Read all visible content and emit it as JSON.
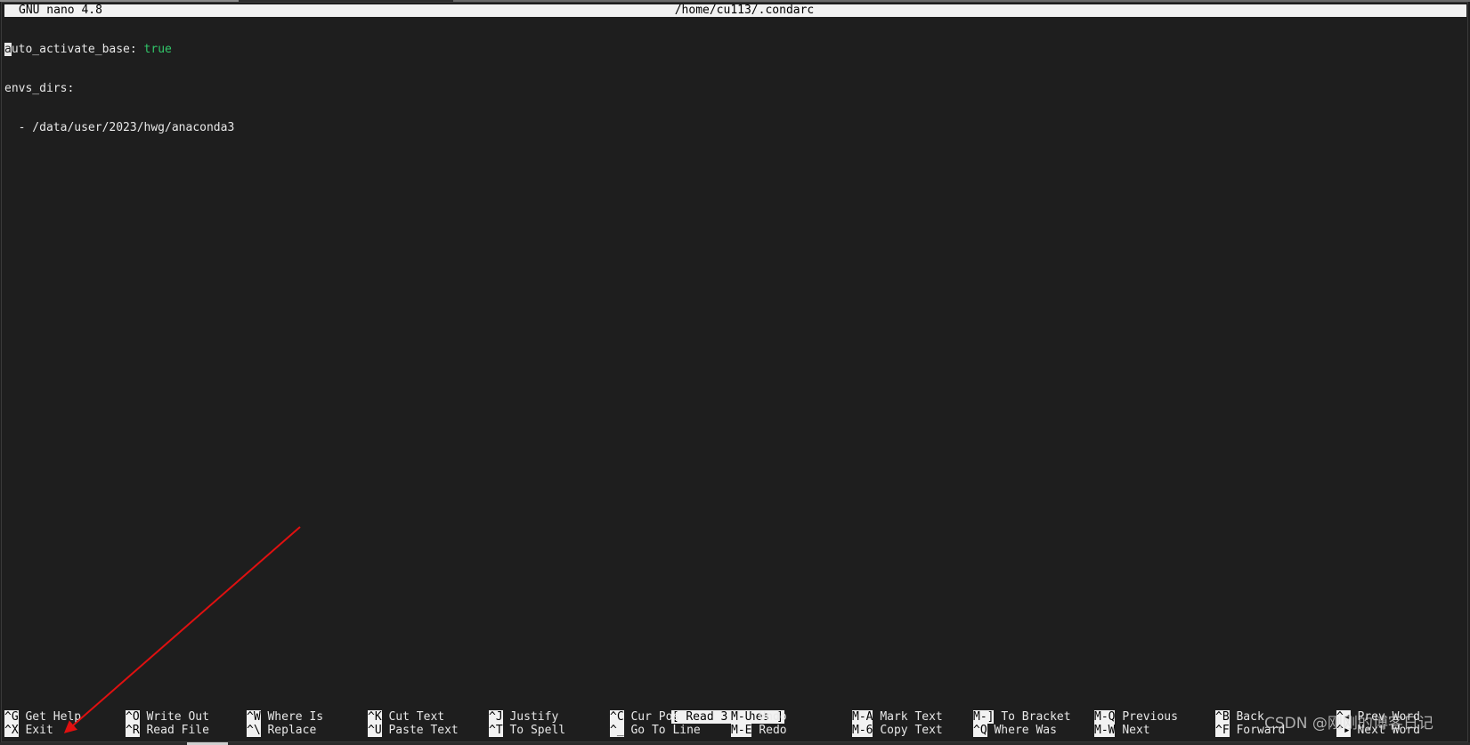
{
  "titlebar": {
    "app": "GNU nano 4.8",
    "file_path": "/home/cu113/.condarc"
  },
  "editor": {
    "cursor_char": "a",
    "line1_key_rest": "uto_activate_base:",
    "line1_value": "true",
    "line2": "envs_dirs:",
    "line3": "  - /data/user/2023/hwg/anaconda3"
  },
  "status_message": "[ Read 3 lines ]",
  "shortcuts": {
    "row1": [
      {
        "key": "^G",
        "label": "Get Help"
      },
      {
        "key": "^O",
        "label": "Write Out"
      },
      {
        "key": "^W",
        "label": "Where Is"
      },
      {
        "key": "^K",
        "label": "Cut Text"
      },
      {
        "key": "^J",
        "label": "Justify"
      },
      {
        "key": "^C",
        "label": "Cur Pos"
      },
      {
        "key": "M-U",
        "label": "Undo"
      },
      {
        "key": "M-A",
        "label": "Mark Text"
      },
      {
        "key": "M-]",
        "label": "To Bracket"
      },
      {
        "key": "M-Q",
        "label": "Previous"
      },
      {
        "key": "^B",
        "label": "Back"
      },
      {
        "key": "^◂",
        "label": "Prev Word"
      }
    ],
    "row2": [
      {
        "key": "^X",
        "label": "Exit"
      },
      {
        "key": "^R",
        "label": "Read File"
      },
      {
        "key": "^\\",
        "label": "Replace"
      },
      {
        "key": "^U",
        "label": "Paste Text"
      },
      {
        "key": "^T",
        "label": "To Spell"
      },
      {
        "key": "^_",
        "label": "Go To Line"
      },
      {
        "key": "M-E",
        "label": "Redo"
      },
      {
        "key": "M-6",
        "label": "Copy Text"
      },
      {
        "key": "^Q",
        "label": "Where Was"
      },
      {
        "key": "M-W",
        "label": "Next"
      },
      {
        "key": "^F",
        "label": "Forward"
      },
      {
        "key": "^▸",
        "label": "Next Word"
      }
    ]
  },
  "watermark": "CSDN @刚刚的博客日记",
  "colors": {
    "background": "#1e1e1e",
    "text": "#e8e8e8",
    "inverse_bg": "#f2f2f2",
    "value_green": "#31c76a",
    "annotation_arrow": "#e01010"
  },
  "annotation": {
    "type": "arrow",
    "color": "#e01010",
    "points_to": "Exit"
  }
}
